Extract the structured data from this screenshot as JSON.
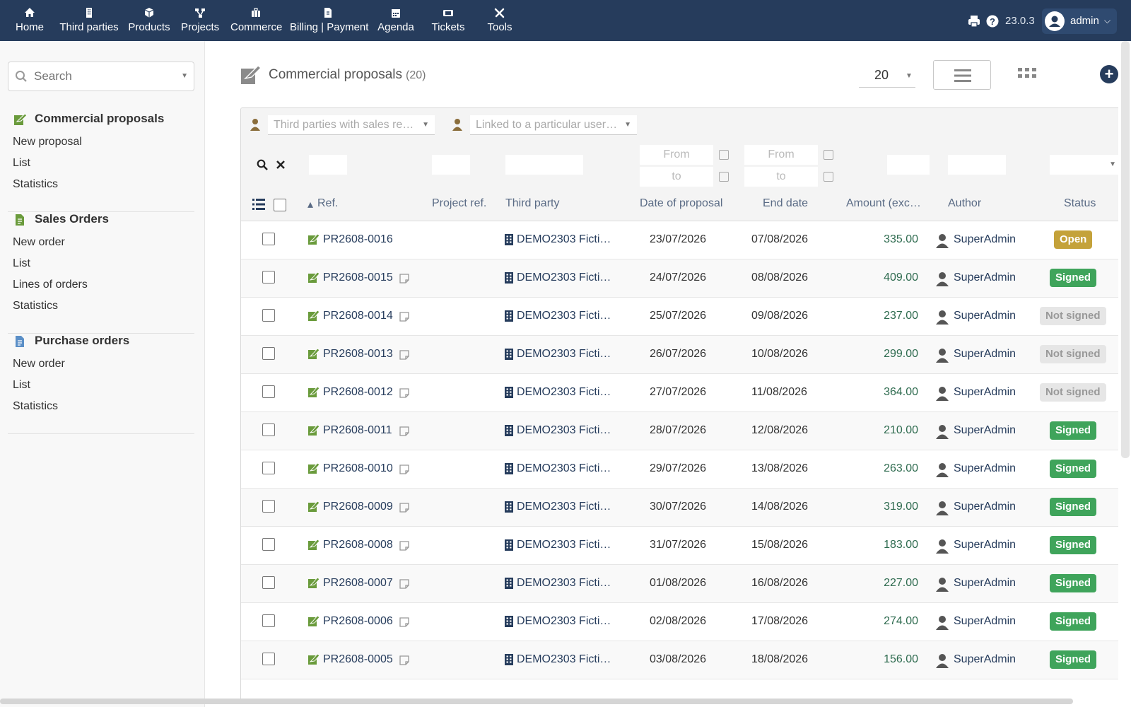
{
  "topbar": {
    "nav": [
      {
        "label": "Home",
        "icon": "home-icon"
      },
      {
        "label": "Third parties",
        "icon": "building-icon"
      },
      {
        "label": "Products",
        "icon": "cube-icon"
      },
      {
        "label": "Projects",
        "icon": "sitemap-icon"
      },
      {
        "label": "Commerce",
        "icon": "suitcase-icon"
      },
      {
        "label": "Billing | Payment",
        "icon": "invoice-icon"
      },
      {
        "label": "Agenda",
        "icon": "calendar-icon"
      },
      {
        "label": "Tickets",
        "icon": "ticket-icon"
      },
      {
        "label": "Tools",
        "icon": "tools-icon"
      }
    ],
    "version": "23.0.3",
    "user": "admin"
  },
  "sidebar": {
    "search_placeholder": "Search",
    "sections": [
      {
        "title": "Commercial proposals",
        "items": [
          "New proposal",
          "List",
          "Statistics"
        ]
      },
      {
        "title": "Sales Orders",
        "items": [
          "New order",
          "List",
          "Lines of orders",
          "Statistics"
        ]
      },
      {
        "title": "Purchase orders",
        "items": [
          "New order",
          "List",
          "Statistics"
        ]
      }
    ]
  },
  "main": {
    "title": "Commercial proposals",
    "count": "(20)",
    "limit": "20",
    "filters": {
      "third_parties_placeholder": "Third parties with sales re…",
      "linked_user_placeholder": "Linked to a particular user…",
      "from": "From",
      "to": "to"
    },
    "columns": [
      "Ref.",
      "Project ref.",
      "Third party",
      "Date of proposal",
      "End date",
      "Amount (exc…",
      "Author",
      "Status"
    ],
    "rows": [
      {
        "ref": "PR2608-0016",
        "party": "DEMO2303 Ficti…",
        "date": "23/07/2026",
        "end": "07/08/2026",
        "amount": "335.00",
        "author": "SuperAdmin",
        "status": "Open"
      },
      {
        "ref": "PR2608-0015",
        "party": "DEMO2303 Ficti…",
        "date": "24/07/2026",
        "end": "08/08/2026",
        "amount": "409.00",
        "author": "SuperAdmin",
        "status": "Signed"
      },
      {
        "ref": "PR2608-0014",
        "party": "DEMO2303 Ficti…",
        "date": "25/07/2026",
        "end": "09/08/2026",
        "amount": "237.00",
        "author": "SuperAdmin",
        "status": "Not signed"
      },
      {
        "ref": "PR2608-0013",
        "party": "DEMO2303 Ficti…",
        "date": "26/07/2026",
        "end": "10/08/2026",
        "amount": "299.00",
        "author": "SuperAdmin",
        "status": "Not signed"
      },
      {
        "ref": "PR2608-0012",
        "party": "DEMO2303 Ficti…",
        "date": "27/07/2026",
        "end": "11/08/2026",
        "amount": "364.00",
        "author": "SuperAdmin",
        "status": "Not signed"
      },
      {
        "ref": "PR2608-0011",
        "party": "DEMO2303 Ficti…",
        "date": "28/07/2026",
        "end": "12/08/2026",
        "amount": "210.00",
        "author": "SuperAdmin",
        "status": "Signed"
      },
      {
        "ref": "PR2608-0010",
        "party": "DEMO2303 Ficti…",
        "date": "29/07/2026",
        "end": "13/08/2026",
        "amount": "263.00",
        "author": "SuperAdmin",
        "status": "Signed"
      },
      {
        "ref": "PR2608-0009",
        "party": "DEMO2303 Ficti…",
        "date": "30/07/2026",
        "end": "14/08/2026",
        "amount": "319.00",
        "author": "SuperAdmin",
        "status": "Signed"
      },
      {
        "ref": "PR2608-0008",
        "party": "DEMO2303 Ficti…",
        "date": "31/07/2026",
        "end": "15/08/2026",
        "amount": "183.00",
        "author": "SuperAdmin",
        "status": "Signed"
      },
      {
        "ref": "PR2608-0007",
        "party": "DEMO2303 Ficti…",
        "date": "01/08/2026",
        "end": "16/08/2026",
        "amount": "227.00",
        "author": "SuperAdmin",
        "status": "Signed"
      },
      {
        "ref": "PR2608-0006",
        "party": "DEMO2303 Ficti…",
        "date": "02/08/2026",
        "end": "17/08/2026",
        "amount": "274.00",
        "author": "SuperAdmin",
        "status": "Signed"
      },
      {
        "ref": "PR2608-0005",
        "party": "DEMO2303 Ficti…",
        "date": "03/08/2026",
        "end": "18/08/2026",
        "amount": "156.00",
        "author": "SuperAdmin",
        "status": "Signed"
      }
    ],
    "status_colors": {
      "Open": "#c4a23a",
      "Signed": "#3fa45b",
      "Not signed": "#e6e6e6"
    }
  }
}
